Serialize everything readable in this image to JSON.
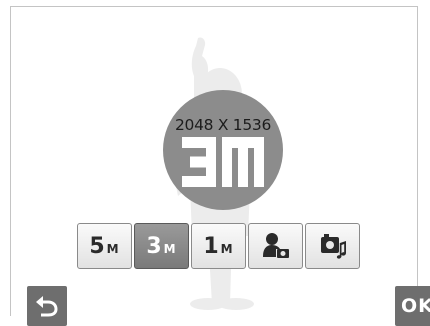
{
  "resolution": {
    "text": "2048 X 1536",
    "size_label": "3M"
  },
  "options": [
    {
      "value": "5",
      "unit": "M",
      "selected": false
    },
    {
      "value": "3",
      "unit": "M",
      "selected": true
    },
    {
      "value": "1",
      "unit": "M",
      "selected": false
    }
  ],
  "icons": {
    "portrait": "person-camera-icon",
    "multimedia": "photo-music-icon",
    "back": "back-arrow-icon"
  },
  "ok_button": {
    "label": "OK"
  },
  "colors": {
    "circle": "#8c8c8c",
    "selected_option": "#8a8a8a",
    "button": "#6e6e6e"
  }
}
